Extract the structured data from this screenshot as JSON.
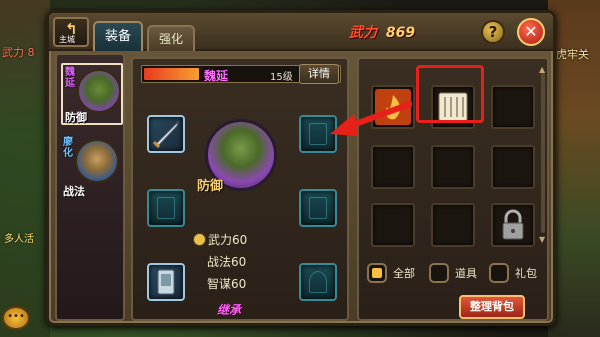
{
  "game": {
    "background": {
      "left_text_1": "武力 8",
      "left_text_2": "多人活",
      "right_text_1": "虎牢关"
    },
    "header": {
      "back_label": "主城",
      "tabs": [
        {
          "label": "装备",
          "active": true
        },
        {
          "label": "强化",
          "active": false
        }
      ],
      "power_label": "武力",
      "power_value": "869",
      "help_icon": "question-icon",
      "close_icon": "close-icon"
    },
    "heroes": [
      {
        "name": "魏延",
        "role": "防御",
        "selected": true
      },
      {
        "name": "廖化",
        "role": "战法",
        "selected": false
      }
    ],
    "hero_detail": {
      "name": "魏延",
      "level": "15级",
      "exp_fraction": 0.28,
      "detail_label": "详情",
      "role": "防御",
      "stats": [
        {
          "label": "武力",
          "value": "60"
        },
        {
          "label": "战法",
          "value": "60"
        },
        {
          "label": "智谋",
          "value": "60"
        }
      ],
      "inherit_label": "继承"
    },
    "equipment_slots": [
      {
        "slot": "weapon",
        "equipped": true,
        "icon": "sword-icon"
      },
      {
        "slot": "book",
        "equipped": false,
        "icon": "book-icon"
      },
      {
        "slot": "armor",
        "equipped": false,
        "icon": "armor-icon"
      },
      {
        "slot": "robe",
        "equipped": false,
        "icon": "robe-icon"
      },
      {
        "slot": "token",
        "equipped": true,
        "icon": "token-icon"
      },
      {
        "slot": "mount",
        "equipped": false,
        "icon": "horse-icon"
      }
    ],
    "inventory": {
      "items": [
        {
          "icon": "flame-icon",
          "empty": false
        },
        {
          "icon": "scroll-icon",
          "empty": false,
          "highlighted": true
        },
        {
          "icon": "",
          "empty": true
        },
        {
          "icon": "",
          "empty": true
        },
        {
          "icon": "",
          "empty": true
        },
        {
          "icon": "",
          "empty": true
        },
        {
          "icon": "",
          "empty": true
        },
        {
          "icon": "",
          "empty": true
        },
        {
          "icon": "lock-icon",
          "empty": true,
          "locked": true
        }
      ],
      "filters": [
        {
          "label": "全部",
          "checked": true
        },
        {
          "label": "道具",
          "checked": false
        },
        {
          "label": "礼包",
          "checked": false
        }
      ],
      "sort_label": "整理背包"
    },
    "colors": {
      "accent_red": "#e8201a",
      "power_red": "#ff5030",
      "hero_purple": "#e060ff"
    }
  }
}
